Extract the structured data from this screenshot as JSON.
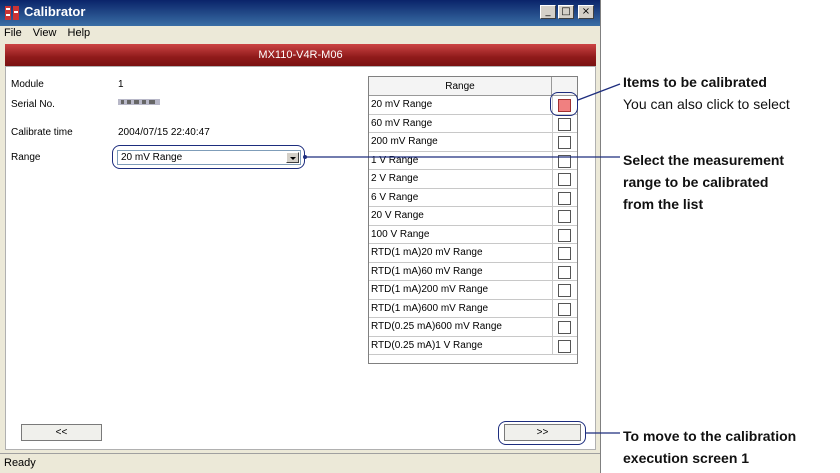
{
  "window": {
    "title": "Calibrator",
    "controls": {
      "minimize": "_",
      "maximize": "□",
      "close": "×"
    }
  },
  "menu": [
    "File",
    "View",
    "Help"
  ],
  "header_bar": "MX110-V4R-M06",
  "fields": {
    "module_label": "Module",
    "module_value": "1",
    "serial_label": "Serial No.",
    "calibrate_time_label": "Calibrate time",
    "calibrate_time_value": "2004/07/15 22:40:47",
    "range_label": "Range",
    "range_selected": "20 mV Range"
  },
  "range_table": {
    "header": "Range",
    "rows": [
      {
        "label": "20 mV Range",
        "checked": true
      },
      {
        "label": "60 mV Range",
        "checked": false
      },
      {
        "label": "200 mV Range",
        "checked": false
      },
      {
        "label": "1 V Range",
        "checked": false
      },
      {
        "label": "2 V Range",
        "checked": false
      },
      {
        "label": "6 V Range",
        "checked": false
      },
      {
        "label": "20 V Range",
        "checked": false
      },
      {
        "label": "100 V Range",
        "checked": false
      },
      {
        "label": "RTD(1 mA)20 mV Range",
        "checked": false
      },
      {
        "label": "RTD(1 mA)60 mV Range",
        "checked": false
      },
      {
        "label": "RTD(1 mA)200 mV Range",
        "checked": false
      },
      {
        "label": "RTD(1 mA)600 mV Range",
        "checked": false
      },
      {
        "label": "RTD(0.25 mA)600 mV Range",
        "checked": false
      },
      {
        "label": "RTD(0.25 mA)1 V Range",
        "checked": false
      }
    ]
  },
  "buttons": {
    "prev": "<<",
    "next": ">>"
  },
  "status": "Ready",
  "annotations": {
    "items_title": "Items to be calibrated",
    "items_sub": "You can also click to select",
    "range_line1": "Select the measurement",
    "range_line2": "range to be calibrated",
    "range_line3": "from the list",
    "next_line1": "To move to the calibration",
    "next_line2": "execution screen 1"
  },
  "colors": {
    "title_bar": "#0a246a",
    "header_bar": "#8f1a1a",
    "checked_box": "#f08080",
    "callout": "#1d2d7e"
  }
}
